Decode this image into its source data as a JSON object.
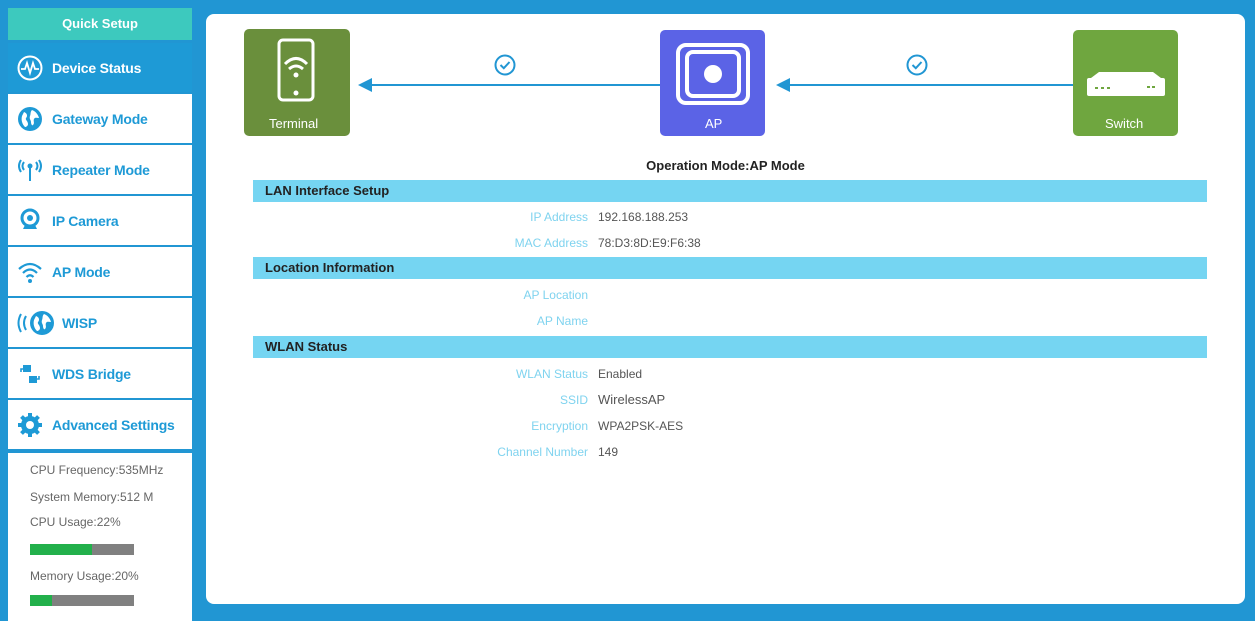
{
  "sidebar": {
    "quick_setup": "Quick Setup",
    "items": [
      {
        "label": "Device Status",
        "icon": "pulse-icon",
        "active": true
      },
      {
        "label": "Gateway Mode",
        "icon": "globe-icon"
      },
      {
        "label": "Repeater Mode",
        "icon": "repeater-icon"
      },
      {
        "label": "IP Camera",
        "icon": "camera-icon"
      },
      {
        "label": "AP Mode",
        "icon": "wifi-icon"
      },
      {
        "label": "WISP",
        "icon": "wisp-icon"
      },
      {
        "label": "WDS Bridge",
        "icon": "wds-icon"
      },
      {
        "label": "Advanced Settings",
        "icon": "gear-icon"
      }
    ],
    "system": {
      "cpu_frequency": "CPU Frequency:535MHz",
      "system_memory": "System Memory:512 M",
      "cpu_usage_label": "CPU Usage:22%",
      "cpu_usage": 0.22,
      "memory_usage_label": "Memory Usage:20%",
      "memory_usage": 0.2
    }
  },
  "topology": {
    "terminal_label": "Terminal",
    "ap_label": "AP",
    "switch_label": "Switch"
  },
  "operation_mode": "Operation Mode:AP Mode",
  "lan": {
    "title": "LAN Interface Setup",
    "ip_label": "IP Address",
    "ip_value": "192.168.188.253",
    "mac_label": "MAC Address",
    "mac_value": "78:D3:8D:E9:F6:38"
  },
  "location": {
    "title": "Location Information",
    "ap_location_label": "AP Location",
    "ap_location_value": "",
    "ap_name_label": "AP Name",
    "ap_name_value": ""
  },
  "wlan": {
    "title": "WLAN Status",
    "status_label": "WLAN Status",
    "status_value": "Enabled",
    "ssid_label": "SSID",
    "ssid_value": "WirelessAP",
    "encryption_label": "Encryption",
    "encryption_value": "WPA2PSK-AES",
    "channel_label": "Channel Number",
    "channel_value": "149"
  },
  "colors": {
    "primary_blue": "#2196d3",
    "teal": "#3dc9be",
    "terminal_green": "#6a8f3c",
    "switch_green": "#6fa63f",
    "ap_purple": "#5b63e6",
    "section_bg": "#75d5f2",
    "progress_green": "#22b04b"
  }
}
